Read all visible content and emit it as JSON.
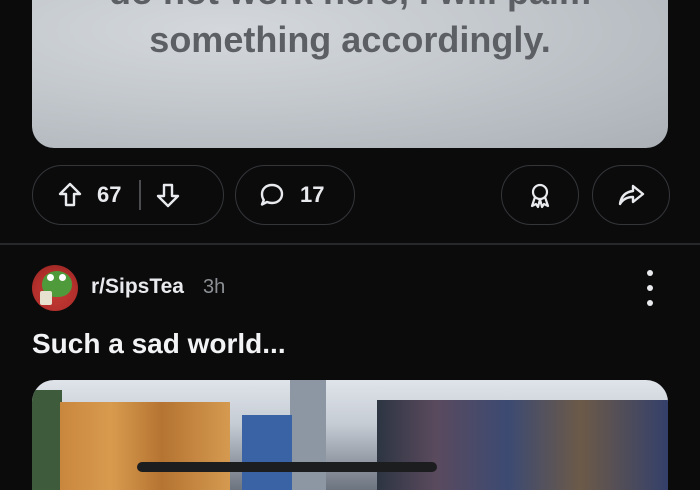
{
  "previous_post": {
    "meme_text_lines": [
      "do not work here, I will palm",
      "something accordingly."
    ],
    "upvotes": "67",
    "comments": "17",
    "icons": {
      "upvote": "arrow-up-icon",
      "downvote": "arrow-down-icon",
      "comment": "comment-bubble-icon",
      "award": "award-icon",
      "share": "share-icon"
    }
  },
  "post": {
    "subreddit": "r/SipsTea",
    "time_ago": "3h",
    "title": "Such a sad world...",
    "icons": {
      "avatar": "frog-avatar-icon",
      "more": "more-vertical-icon"
    }
  },
  "colors": {
    "background": "#0b0b0c",
    "pill_border": "#34363a",
    "text": "#e8eaed",
    "muted": "#8c9094"
  }
}
